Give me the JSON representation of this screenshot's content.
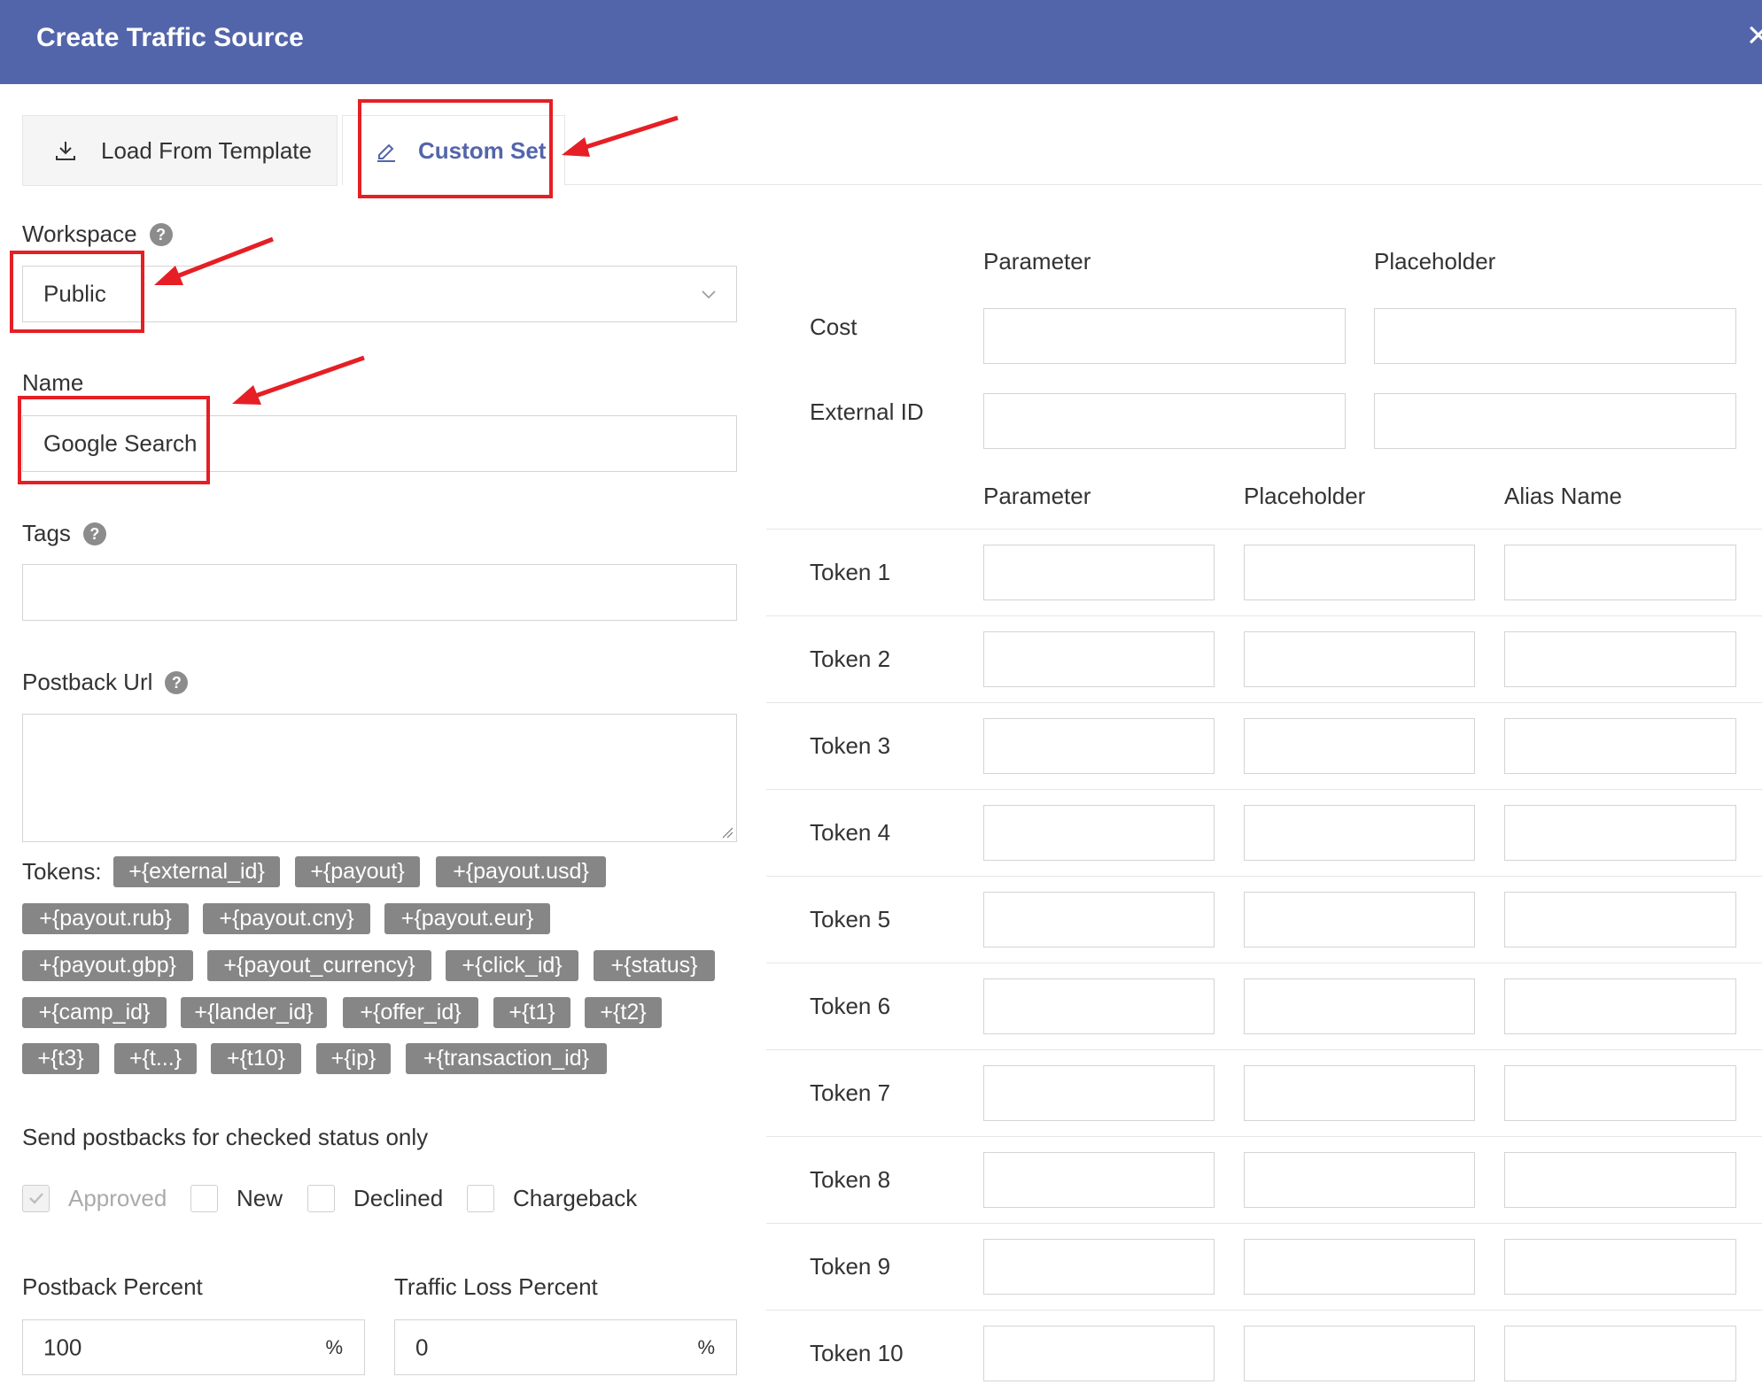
{
  "dialog": {
    "title": "Create Traffic Source",
    "close_label": "×"
  },
  "tabs": [
    {
      "label": "Load From Template",
      "icon": "download-icon",
      "active": false
    },
    {
      "label": "Custom Set",
      "icon": "pencil-icon",
      "active": true
    }
  ],
  "form": {
    "workspace": {
      "label": "Workspace",
      "value": "Public"
    },
    "name": {
      "label": "Name",
      "value": "Google Search"
    },
    "tags": {
      "label": "Tags",
      "value": ""
    },
    "postback_url": {
      "label": "Postback Url",
      "value": ""
    },
    "tokens_label": "Tokens:",
    "tokens": [
      "+{external_id}",
      "+{payout}",
      "+{payout.usd}",
      "+{payout.rub}",
      "+{payout.cny}",
      "+{payout.eur}",
      "+{payout.gbp}",
      "+{payout_currency}",
      "+{click_id}",
      "+{status}",
      "+{camp_id}",
      "+{lander_id}",
      "+{offer_id}",
      "+{t1}",
      "+{t2}",
      "+{t3}",
      "+{t...}",
      "+{t10}",
      "+{ip}",
      "+{transaction_id}"
    ],
    "status_section_label": "Send postbacks for checked status only",
    "statuses": [
      {
        "label": "Approved",
        "checked": true,
        "disabled": true
      },
      {
        "label": "New",
        "checked": false,
        "disabled": false
      },
      {
        "label": "Declined",
        "checked": false,
        "disabled": false
      },
      {
        "label": "Chargeback",
        "checked": false,
        "disabled": false
      }
    ],
    "postback_percent": {
      "label": "Postback Percent",
      "value": "100",
      "unit": "%"
    },
    "traffic_loss_percent": {
      "label": "Traffic Loss Percent",
      "value": "0",
      "unit": "%"
    }
  },
  "params": {
    "headers": {
      "parameter": "Parameter",
      "placeholder": "Placeholder"
    },
    "rows": [
      {
        "label": "Cost"
      },
      {
        "label": "External ID"
      }
    ]
  },
  "token_params": {
    "headers": {
      "parameter": "Parameter",
      "placeholder": "Placeholder",
      "alias": "Alias Name"
    },
    "rows": [
      {
        "label": "Token 1"
      },
      {
        "label": "Token 2"
      },
      {
        "label": "Token 3"
      },
      {
        "label": "Token 4"
      },
      {
        "label": "Token 5"
      },
      {
        "label": "Token 6"
      },
      {
        "label": "Token 7"
      },
      {
        "label": "Token 8"
      },
      {
        "label": "Token 9"
      },
      {
        "label": "Token 10"
      }
    ]
  },
  "colors": {
    "header_bg": "#5365aa",
    "chip_bg": "#868686",
    "annotation_red": "#e51f25"
  }
}
